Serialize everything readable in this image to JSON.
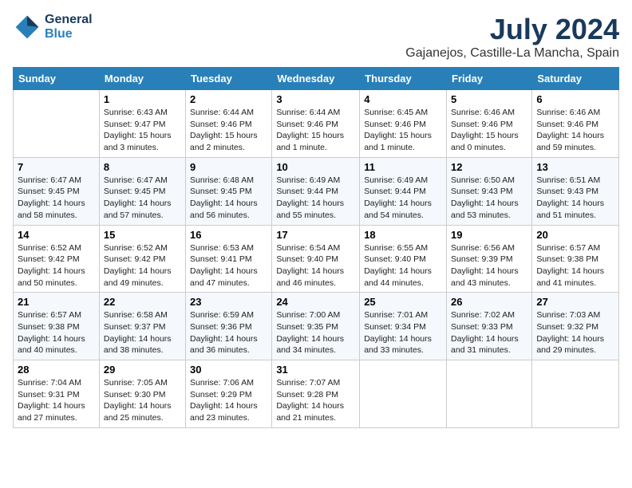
{
  "header": {
    "logo_line1": "General",
    "logo_line2": "Blue",
    "month": "July 2024",
    "location": "Gajanejos, Castille-La Mancha, Spain"
  },
  "days_of_week": [
    "Sunday",
    "Monday",
    "Tuesday",
    "Wednesday",
    "Thursday",
    "Friday",
    "Saturday"
  ],
  "weeks": [
    [
      {
        "day": "",
        "sunrise": "",
        "sunset": "",
        "daylight": ""
      },
      {
        "day": "1",
        "sunrise": "Sunrise: 6:43 AM",
        "sunset": "Sunset: 9:47 PM",
        "daylight": "Daylight: 15 hours and 3 minutes."
      },
      {
        "day": "2",
        "sunrise": "Sunrise: 6:44 AM",
        "sunset": "Sunset: 9:46 PM",
        "daylight": "Daylight: 15 hours and 2 minutes."
      },
      {
        "day": "3",
        "sunrise": "Sunrise: 6:44 AM",
        "sunset": "Sunset: 9:46 PM",
        "daylight": "Daylight: 15 hours and 1 minute."
      },
      {
        "day": "4",
        "sunrise": "Sunrise: 6:45 AM",
        "sunset": "Sunset: 9:46 PM",
        "daylight": "Daylight: 15 hours and 1 minute."
      },
      {
        "day": "5",
        "sunrise": "Sunrise: 6:46 AM",
        "sunset": "Sunset: 9:46 PM",
        "daylight": "Daylight: 15 hours and 0 minutes."
      },
      {
        "day": "6",
        "sunrise": "Sunrise: 6:46 AM",
        "sunset": "Sunset: 9:46 PM",
        "daylight": "Daylight: 14 hours and 59 minutes."
      }
    ],
    [
      {
        "day": "7",
        "sunrise": "Sunrise: 6:47 AM",
        "sunset": "Sunset: 9:45 PM",
        "daylight": "Daylight: 14 hours and 58 minutes."
      },
      {
        "day": "8",
        "sunrise": "Sunrise: 6:47 AM",
        "sunset": "Sunset: 9:45 PM",
        "daylight": "Daylight: 14 hours and 57 minutes."
      },
      {
        "day": "9",
        "sunrise": "Sunrise: 6:48 AM",
        "sunset": "Sunset: 9:45 PM",
        "daylight": "Daylight: 14 hours and 56 minutes."
      },
      {
        "day": "10",
        "sunrise": "Sunrise: 6:49 AM",
        "sunset": "Sunset: 9:44 PM",
        "daylight": "Daylight: 14 hours and 55 minutes."
      },
      {
        "day": "11",
        "sunrise": "Sunrise: 6:49 AM",
        "sunset": "Sunset: 9:44 PM",
        "daylight": "Daylight: 14 hours and 54 minutes."
      },
      {
        "day": "12",
        "sunrise": "Sunrise: 6:50 AM",
        "sunset": "Sunset: 9:43 PM",
        "daylight": "Daylight: 14 hours and 53 minutes."
      },
      {
        "day": "13",
        "sunrise": "Sunrise: 6:51 AM",
        "sunset": "Sunset: 9:43 PM",
        "daylight": "Daylight: 14 hours and 51 minutes."
      }
    ],
    [
      {
        "day": "14",
        "sunrise": "Sunrise: 6:52 AM",
        "sunset": "Sunset: 9:42 PM",
        "daylight": "Daylight: 14 hours and 50 minutes."
      },
      {
        "day": "15",
        "sunrise": "Sunrise: 6:52 AM",
        "sunset": "Sunset: 9:42 PM",
        "daylight": "Daylight: 14 hours and 49 minutes."
      },
      {
        "day": "16",
        "sunrise": "Sunrise: 6:53 AM",
        "sunset": "Sunset: 9:41 PM",
        "daylight": "Daylight: 14 hours and 47 minutes."
      },
      {
        "day": "17",
        "sunrise": "Sunrise: 6:54 AM",
        "sunset": "Sunset: 9:40 PM",
        "daylight": "Daylight: 14 hours and 46 minutes."
      },
      {
        "day": "18",
        "sunrise": "Sunrise: 6:55 AM",
        "sunset": "Sunset: 9:40 PM",
        "daylight": "Daylight: 14 hours and 44 minutes."
      },
      {
        "day": "19",
        "sunrise": "Sunrise: 6:56 AM",
        "sunset": "Sunset: 9:39 PM",
        "daylight": "Daylight: 14 hours and 43 minutes."
      },
      {
        "day": "20",
        "sunrise": "Sunrise: 6:57 AM",
        "sunset": "Sunset: 9:38 PM",
        "daylight": "Daylight: 14 hours and 41 minutes."
      }
    ],
    [
      {
        "day": "21",
        "sunrise": "Sunrise: 6:57 AM",
        "sunset": "Sunset: 9:38 PM",
        "daylight": "Daylight: 14 hours and 40 minutes."
      },
      {
        "day": "22",
        "sunrise": "Sunrise: 6:58 AM",
        "sunset": "Sunset: 9:37 PM",
        "daylight": "Daylight: 14 hours and 38 minutes."
      },
      {
        "day": "23",
        "sunrise": "Sunrise: 6:59 AM",
        "sunset": "Sunset: 9:36 PM",
        "daylight": "Daylight: 14 hours and 36 minutes."
      },
      {
        "day": "24",
        "sunrise": "Sunrise: 7:00 AM",
        "sunset": "Sunset: 9:35 PM",
        "daylight": "Daylight: 14 hours and 34 minutes."
      },
      {
        "day": "25",
        "sunrise": "Sunrise: 7:01 AM",
        "sunset": "Sunset: 9:34 PM",
        "daylight": "Daylight: 14 hours and 33 minutes."
      },
      {
        "day": "26",
        "sunrise": "Sunrise: 7:02 AM",
        "sunset": "Sunset: 9:33 PM",
        "daylight": "Daylight: 14 hours and 31 minutes."
      },
      {
        "day": "27",
        "sunrise": "Sunrise: 7:03 AM",
        "sunset": "Sunset: 9:32 PM",
        "daylight": "Daylight: 14 hours and 29 minutes."
      }
    ],
    [
      {
        "day": "28",
        "sunrise": "Sunrise: 7:04 AM",
        "sunset": "Sunset: 9:31 PM",
        "daylight": "Daylight: 14 hours and 27 minutes."
      },
      {
        "day": "29",
        "sunrise": "Sunrise: 7:05 AM",
        "sunset": "Sunset: 9:30 PM",
        "daylight": "Daylight: 14 hours and 25 minutes."
      },
      {
        "day": "30",
        "sunrise": "Sunrise: 7:06 AM",
        "sunset": "Sunset: 9:29 PM",
        "daylight": "Daylight: 14 hours and 23 minutes."
      },
      {
        "day": "31",
        "sunrise": "Sunrise: 7:07 AM",
        "sunset": "Sunset: 9:28 PM",
        "daylight": "Daylight: 14 hours and 21 minutes."
      },
      {
        "day": "",
        "sunrise": "",
        "sunset": "",
        "daylight": ""
      },
      {
        "day": "",
        "sunrise": "",
        "sunset": "",
        "daylight": ""
      },
      {
        "day": "",
        "sunrise": "",
        "sunset": "",
        "daylight": ""
      }
    ]
  ]
}
